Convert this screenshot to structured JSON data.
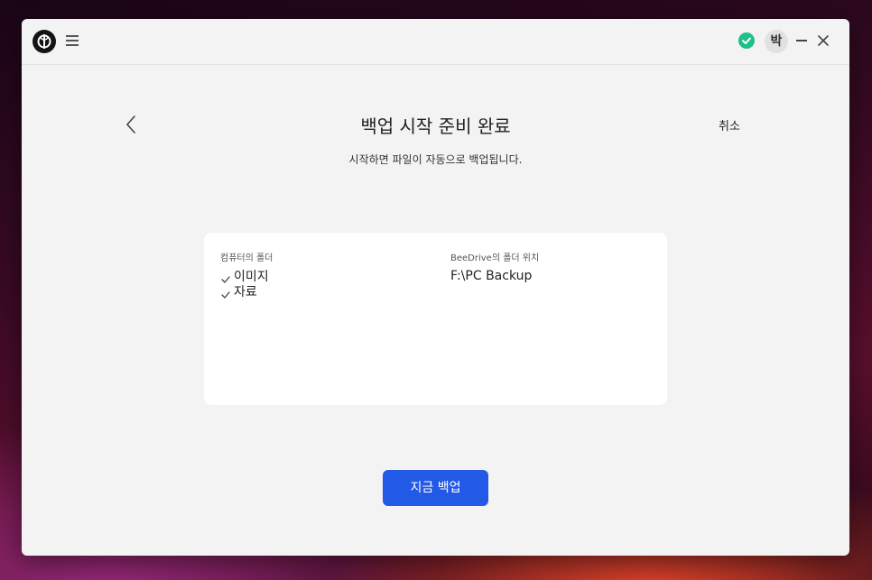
{
  "titlebar": {
    "logo_icon": "beedrive-logo-icon",
    "menu_icon": "hamburger-menu-icon",
    "status_icon": "check-circle-icon",
    "status_color": "#1fbf8a",
    "avatar_text": "박",
    "minimize_icon": "minimize-icon",
    "close_icon": "close-icon"
  },
  "header": {
    "back_icon": "chevron-left-icon",
    "title": "백업 시작 준비 완료",
    "subtitle": "시작하면 파일이 자동으로 백업됩니다.",
    "cancel_label": "취소"
  },
  "summary": {
    "source_label": "컴퓨터의 폴더",
    "folders": [
      {
        "name": "이미지",
        "icon": "check-icon"
      },
      {
        "name": "자료",
        "icon": "check-icon"
      }
    ],
    "dest_label": "BeeDrive의 폴더 위치",
    "dest_path": "F:\\PC Backup"
  },
  "actions": {
    "backup_now_label": "지금 백업",
    "accent_color": "#2259e6"
  }
}
